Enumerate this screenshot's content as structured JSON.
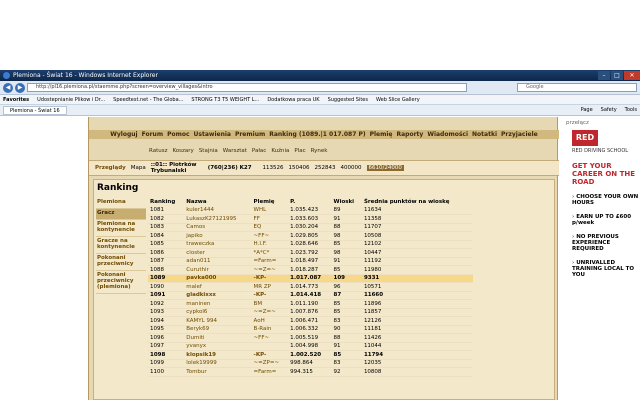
{
  "browser": {
    "title": "Plemiona - Świat 16 - Windows Internet Explorer",
    "url": "http://pl16.plemiona.pl/staemme.php?screen=overview_villages&intro",
    "search_placeholder": "Google",
    "favorites_label": "Favorites",
    "favorites": [
      "Udostepnianie Plikow i Dr...",
      "Speedtest.net - The Globa...",
      "STRONG T3 T5 WEIGHT L...",
      "Dodatkowa praca UK",
      "Suggested Sites",
      "Web Slice Gallery"
    ],
    "tab": "Plemiona - Świat 16",
    "tools": [
      "Page",
      "Safety",
      "Tools"
    ]
  },
  "game": {
    "menu": [
      "Wyloguj",
      "Forum",
      "Pomoc",
      "Ustawienia",
      "Premium",
      "Ranking (1089.|1 017.087 P)",
      "Plemię",
      "Raporty",
      "Wiadomości",
      "Notatki",
      "Przyjaciele"
    ],
    "buildings": [
      "Ratusz",
      "Koszary",
      "Stajnia",
      "Warsztat",
      "Pałac",
      "Kuźnia",
      "Plac",
      "Rynek"
    ],
    "village": {
      "links": [
        "Przeglądy",
        "Mapa"
      ],
      "name": "::01:: Piotrków Trybunalski",
      "coords": "(760|236) K27",
      "wood": "113526",
      "clay": "150406",
      "iron": "252843",
      "storage": "400000",
      "population": "6610/24000"
    }
  },
  "ranking": {
    "title": "Ranking",
    "menu": [
      "Plemiona",
      "Gracz",
      "Plemiona na kontynencie",
      "Gracze na kontynencie",
      "Pokonani przeciwnicy",
      "Pokonani przeciwnicy (plemiona)"
    ],
    "selected_menu": 1,
    "columns": [
      "Ranking",
      "Nazwa",
      "Plemię",
      "P.",
      "Wioski",
      "Średnia punktów na wioskę"
    ],
    "rows": [
      {
        "rank": "1081",
        "name": "kuler1444",
        "tribe": "WHL",
        "points": "1.035.423",
        "villages": "89",
        "avg": "11634"
      },
      {
        "rank": "1082",
        "name": "LukaszK27121995",
        "tribe": "FF",
        "points": "1.033.603",
        "villages": "91",
        "avg": "11358"
      },
      {
        "rank": "1083",
        "name": "Camos",
        "tribe": "EQ",
        "points": "1.030.204",
        "villages": "88",
        "avg": "11707"
      },
      {
        "rank": "1084",
        "name": "japiko",
        "tribe": "~FF~",
        "points": "1.029.805",
        "villages": "98",
        "avg": "10508"
      },
      {
        "rank": "1085",
        "name": "traweczka",
        "tribe": "H.I.F.",
        "points": "1.028.646",
        "villages": "85",
        "avg": "12102"
      },
      {
        "rank": "1086",
        "name": "closter",
        "tribe": "*A*C*",
        "points": "1.023.792",
        "villages": "98",
        "avg": "10447"
      },
      {
        "rank": "1087",
        "name": "adan011",
        "tribe": "=Farm=",
        "points": "1.018.497",
        "villages": "91",
        "avg": "11192"
      },
      {
        "rank": "1088",
        "name": "Curuthir",
        "tribe": "~=Z=~",
        "points": "1.018.287",
        "villages": "85",
        "avg": "11980"
      },
      {
        "rank": "1089",
        "name": "pavka000",
        "tribe": "-KP-",
        "points": "1.017.087",
        "villages": "109",
        "avg": "9331"
      },
      {
        "rank": "1090",
        "name": "malef",
        "tribe": "MR ZP",
        "points": "1.014.773",
        "villages": "96",
        "avg": "10571"
      },
      {
        "rank": "1091",
        "name": "gladkixxx",
        "tribe": "-KP-",
        "points": "1.014.418",
        "villages": "87",
        "avg": "11660"
      },
      {
        "rank": "1092",
        "name": "maninen",
        "tribe": "BM",
        "points": "1.011.190",
        "villages": "85",
        "avg": "11896"
      },
      {
        "rank": "1093",
        "name": "cypkol6",
        "tribe": "~=Z=~",
        "points": "1.007.876",
        "villages": "85",
        "avg": "11857"
      },
      {
        "rank": "1094",
        "name": "KAMYL 994",
        "tribe": "AoH",
        "points": "1.006.471",
        "villages": "83",
        "avg": "12126"
      },
      {
        "rank": "1095",
        "name": "Beryk69",
        "tribe": "B-Rain",
        "points": "1.006.332",
        "villages": "90",
        "avg": "11181"
      },
      {
        "rank": "1096",
        "name": "Dumiti",
        "tribe": "~FF~",
        "points": "1.005.519",
        "villages": "88",
        "avg": "11426"
      },
      {
        "rank": "1097",
        "name": "yvanyx",
        "tribe": "",
        "points": "1.004.998",
        "villages": "91",
        "avg": "11044"
      },
      {
        "rank": "1098",
        "name": "klopsik19",
        "tribe": "-KP-",
        "points": "1.002.520",
        "villages": "85",
        "avg": "11794"
      },
      {
        "rank": "1099",
        "name": "lolek19999",
        "tribe": "~=ZP=~",
        "points": "998.864",
        "villages": "83",
        "avg": "12035"
      },
      {
        "rank": "1100",
        "name": "Tombur",
        "tribe": "=Farm=",
        "points": "994.315",
        "villages": "92",
        "avg": "10808"
      }
    ],
    "current_row": 8,
    "bold_rows": [
      8,
      10,
      17
    ]
  },
  "ad": {
    "header": "przełącz",
    "logo": "RED",
    "tagline": "RED DRIVING SCHOOL",
    "title": "GET YOUR CAREER ON THE ROAD",
    "bullets": [
      "CHOOSE YOUR OWN HOURS",
      "EARN UP TO £600 p/week",
      "NO PREVIOUS EXPERIENCE REQUIRED",
      "UNRIVALLED TRAINING LOCAL TO YOU"
    ]
  }
}
